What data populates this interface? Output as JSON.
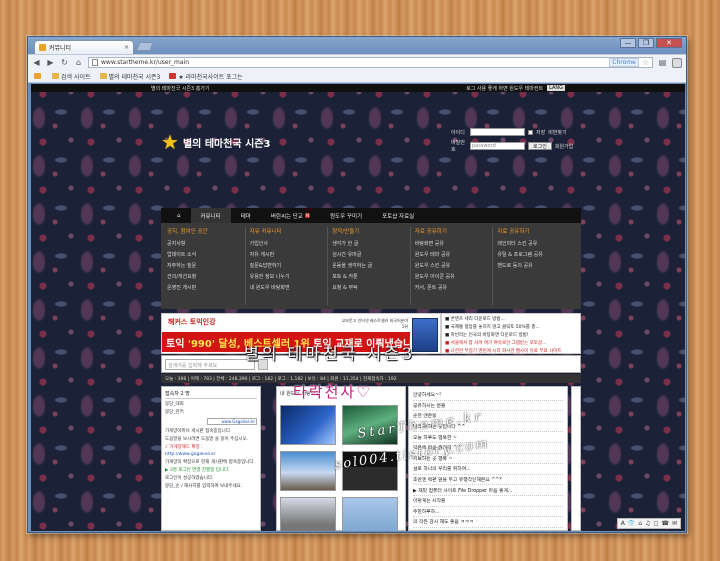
{
  "browser": {
    "tab_title": "커뮤니티",
    "tab_close": "×",
    "url": "www.startheme.kr/user_main",
    "omnibox_hint": "Chrome",
    "window_controls": [
      "—",
      "❐",
      "✕"
    ],
    "bookmarks": [
      "",
      "검색 사이트",
      "별의 테마천국 시즌3",
      "★ 라마천국사이트 포그는"
    ]
  },
  "site": {
    "top_strip_left": "별의 테마천국 시즌3 홈가기",
    "top_strip_right": "로그 사용 좋게 하면 원도우 테마컨트",
    "top_strip_lang": "LANG",
    "logo_title": "별의 테마천국 시즌3",
    "login": {
      "id_label": "아이디",
      "pw_label": "비밀번호",
      "save_label": "저장",
      "login_button": "로그인",
      "find_link": "비번찾기",
      "join_link": "회원가입",
      "pw_placeholder": "password"
    },
    "gnb": [
      "⌂",
      "커뮤니티",
      "테마",
      "버린씨는 단교",
      "원도우 꾸미기",
      "포토샵 자료실"
    ],
    "mega_columns": [
      {
        "head": "공지, 참여인 공간",
        "items": [
          "공지사항",
          "업데이트 소식",
          "자주하는 질문",
          "건의/개선요청",
          "운영진 게시판"
        ]
      },
      {
        "head": "자유 커뮤니티",
        "items": [
          "가입인사",
          "자유 게시판",
          "질문&답변하기",
          "유용한 정보 나누기",
          "내 윈도우 바탕화면"
        ]
      },
      {
        "head": "창작/만들기",
        "items": [
          "생각가 한 글",
          "심시간 유머글",
          "운동을 생각하는 글",
          "포토 & 카툰",
          "요청 & 부탁"
        ]
      },
      {
        "head": "자료 공유하기",
        "items": [
          "바탕화면 공유",
          "윈도우 테마 공유",
          "윈도우 스킨 공유",
          "윈도우 아이콘 공유",
          "커서, 폰트 공유"
        ]
      },
      {
        "head": "자료 공유하기",
        "items": [
          "레인미터 스킨 공유",
          "유틸 & 프로그램 공유",
          "밴드로 등의 공유",
          "",
          ""
        ]
      }
    ],
    "banner": {
      "brand": "해커스 토익인강",
      "small_text": "교보문고 인터넷 베스트셀러 외국어분야 1위",
      "headline_pre": "토익 ",
      "headline_hl1": "'990' 달성, 베스트셀러 1위",
      "headline_post": " 토익 교재로 이뤄냈습니다."
    },
    "side_news": [
      "■ 콘텐츠 세리 다운로드 방법...",
      "■ 국제통 항암를 놓치지 않고 클릭토 50%를 총...",
      "■ 마빈라는 인국의 바탕화면 다운로드 방법!",
      "■ 서울에서 팝 사려 여기 여유로인 그램받는 포토샵...",
      "■ 나한한 무점기 영린에 시작 화사관 웹사이 유료 무료 사이트"
    ],
    "search_placeholder": "검색어를 입력해 주세요",
    "stats_text": "오늘 : 398 | 어제 : 783 | 전체 : 248,390 | 로그 : 182 | 로그 : 1,182 | 보유 : 84 | 회원 : 11,354 | 현재접속자 : 192",
    "left_box": {
      "head": "접속자 2 명",
      "lines": [
        "몽당_대회",
        "몽당_관키",
        "가게양아피브 게시판 접속중입니다.",
        "도움말을 보시려면 도움말 을 읽어 주십시오.",
        "♪ 가게양해드 확장 :",
        "http://www.gagalive.kr",
        "가게양의 확장으로 현재 게시판에 접속중입니다.",
        "▶ 3명 로그인 연결 진행중 입니다.",
        "로그인이 성공하였습니다.",
        "몽당_순 / 해사지를 입력하여 보내주세요."
      ],
      "ad_label": "www.Gagalive.kr"
    },
    "gallery": {
      "head": "내 원도우 바탕화면"
    },
    "board_rows": [
      "안녕하세요~!",
      "공유하시는 분들",
      "순천 앤운동",
      "빌라 취하는 곳입니다 ^^",
      "오늘 하루도 행복한 ~",
      "덕분에 마음 즐거워 ^^",
      "치료하는 곳 행복 ~",
      "설로 하나의 우리를 위하여...",
      "초반엔 떡판 앞을 두고 유행각인해본요 ^^*",
      "▶ 재밌 컴퓨터 사이트 File Dropper 마음 좋게...",
      "이렇게는 시작들",
      "주한하루하...",
      "의 작은 감사 해도 좋음 ㅋㅋㅋ"
    ],
    "watermarks": [
      "별의 테마천국 시즌3",
      "타락천사♡",
      "StarTheme.kr",
      "sol004.tistory.com"
    ],
    "status_icons": [
      "A",
      "👕",
      "⌂",
      "♫",
      "◻",
      "☎",
      "✉"
    ]
  }
}
